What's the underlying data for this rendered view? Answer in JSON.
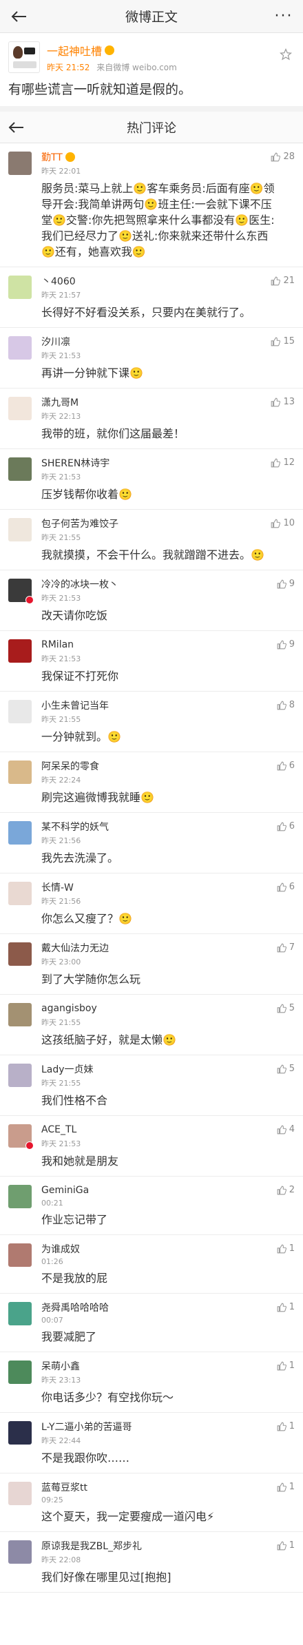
{
  "topbar": {
    "title": "微博正文"
  },
  "post": {
    "author": "一起神吐槽",
    "time": "昨天 21:52",
    "source": "来自微博 weibo.com",
    "text": "有哪些谎言一听就知道是假的。"
  },
  "hot": {
    "title": "热门评论"
  },
  "comments": [
    {
      "name": "勤TT",
      "time": "昨天 22:01",
      "likes": "28",
      "text": "服务员:菜马上就上🙂客车乘务员:后面有座🙂领导开会:我简单讲两句🙂班主任:一会就下课不压堂🙂交警:你先把驾照拿来什么事都没有🙂医生:我们已经尽力了🙂送礼:你来就来还带什么东西🙂还有，她喜欢我🙂"
    },
    {
      "name": "丶4060",
      "time": "昨天 21:57",
      "likes": "21",
      "text": "长得好不好看没关系，只要内在美就行了。"
    },
    {
      "name": "汐川凛",
      "time": "昨天 21:53",
      "likes": "15",
      "text": "再讲一分钟就下课🙂"
    },
    {
      "name": "潇九哥M",
      "time": "昨天 22:13",
      "likes": "13",
      "text": "我带的班，就你们这届最差！"
    },
    {
      "name": "SHEREN林诗宇",
      "time": "昨天 21:53",
      "likes": "12",
      "text": "压岁钱帮你收着🙂"
    },
    {
      "name": "包子何苦为难饺子",
      "time": "昨天 21:55",
      "likes": "10",
      "text": "我就摸摸，不会干什么。我就蹭蹭不进去。🙂"
    },
    {
      "name": "冷冷的冰块一枚丶",
      "time": "昨天 21:53",
      "likes": "9",
      "text": "改天请你吃饭"
    },
    {
      "name": "RMilan",
      "time": "昨天 21:53",
      "likes": "9",
      "text": "我保证不打死你"
    },
    {
      "name": "小生未曾记当年",
      "time": "昨天 21:55",
      "likes": "8",
      "text": "一分钟就到。🙂"
    },
    {
      "name": "阿呆呆的零食",
      "time": "昨天 22:24",
      "likes": "6",
      "text": "刷完这遍微博我就睡🙂"
    },
    {
      "name": "某不科学的妖气",
      "time": "昨天 21:56",
      "likes": "6",
      "text": "我先去洗澡了。"
    },
    {
      "name": "长情-W",
      "time": "昨天 21:56",
      "likes": "6",
      "text": "你怎么又瘦了？🙂"
    },
    {
      "name": "戴大仙法力无边",
      "time": "昨天 23:00",
      "likes": "7",
      "text": "到了大学随你怎么玩"
    },
    {
      "name": "agangisboy",
      "time": "昨天 21:55",
      "likes": "5",
      "text": "这孩纸脑子好，就是太懒🙂"
    },
    {
      "name": "Lady一贞妹",
      "time": "昨天 21:55",
      "likes": "5",
      "text": "我们性格不合"
    },
    {
      "name": "ACE_TL",
      "time": "昨天 21:53",
      "likes": "4",
      "text": "我和她就是朋友"
    },
    {
      "name": "GeminiGa",
      "time": "00:21",
      "likes": "2",
      "text": "作业忘记带了"
    },
    {
      "name": "为谁成奴",
      "time": "01:26",
      "likes": "1",
      "text": "不是我放的屁"
    },
    {
      "name": "尧舜禹哈哈哈哈",
      "time": "00:07",
      "likes": "1",
      "text": "我要减肥了"
    },
    {
      "name": "呆萌小鑫",
      "time": "昨天 23:13",
      "likes": "1",
      "text": "你电话多少？有空找你玩～"
    },
    {
      "name": "L-Y二逼小弟的苦逼哥",
      "time": "昨天 22:44",
      "likes": "1",
      "text": "不是我跟你吹……"
    },
    {
      "name": "蓝莓豆浆tt",
      "time": "09:25",
      "likes": "1",
      "text": "这个夏天，我一定要瘦成一道闪电⚡"
    },
    {
      "name": "原谅我是我ZBL_郑步礼",
      "time": "昨天 22:08",
      "likes": "1",
      "text": "我们好像在哪里见过[抱抱]"
    }
  ],
  "colors": {
    "accent": "#ff8200",
    "vip": "#f86400",
    "badge": "#e6162d"
  },
  "icons": {
    "back": "back-arrow-icon",
    "more": "more-dots-icon",
    "star": "star-icon",
    "like": "thumb-up-icon"
  }
}
